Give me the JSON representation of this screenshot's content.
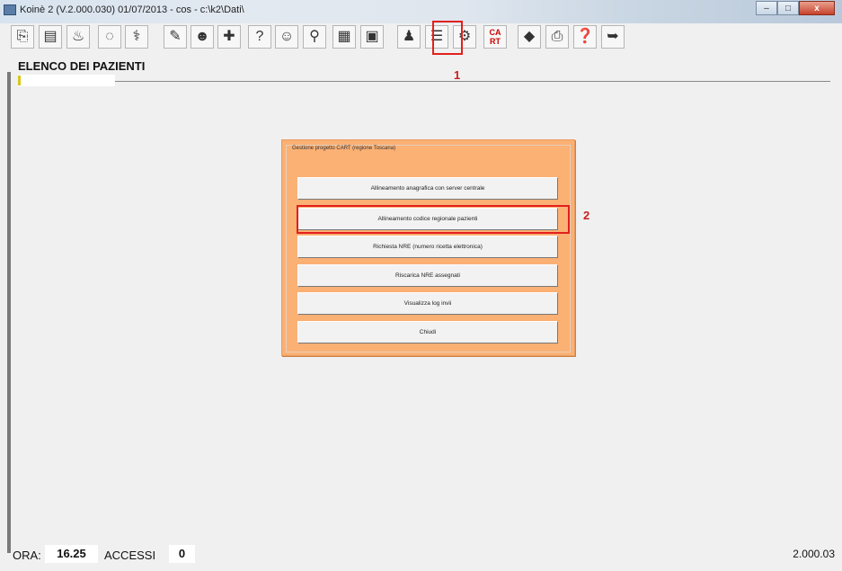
{
  "window": {
    "title": "Koinè 2 (V.2.000.030) 01/07/2013 - cos - c:\\k2\\Dati\\",
    "minimize": "–",
    "maximize": "□",
    "close": "x"
  },
  "toolbar": {
    "icons": [
      {
        "name": "open-icon",
        "glyph": "⎘"
      },
      {
        "name": "archive-icon",
        "glyph": "▤"
      },
      {
        "name": "basket-icon",
        "glyph": "♨"
      },
      {
        "name": "pill-icon",
        "glyph": "◌"
      },
      {
        "name": "medical-icon",
        "glyph": "⚕"
      },
      {
        "name": "document-icon",
        "glyph": "✎"
      },
      {
        "name": "users-icon",
        "glyph": "☻"
      },
      {
        "name": "syringe-icon",
        "glyph": "✚"
      },
      {
        "name": "question-icon",
        "glyph": "?"
      },
      {
        "name": "people-icon",
        "glyph": "☺"
      },
      {
        "name": "magnifier-icon",
        "glyph": "⚲"
      },
      {
        "name": "grid-icon",
        "glyph": "▦"
      },
      {
        "name": "calculator-icon",
        "glyph": "▣"
      },
      {
        "name": "person-group-icon",
        "glyph": "♟"
      },
      {
        "name": "list-icon",
        "glyph": "☰"
      },
      {
        "name": "network-icon",
        "glyph": "⚙"
      },
      {
        "name": "cart-icon",
        "glyph": "CA RT"
      },
      {
        "name": "eraser-icon",
        "glyph": "◆"
      },
      {
        "name": "printer-icon",
        "glyph": "⎙"
      },
      {
        "name": "help-icon",
        "glyph": "❓"
      },
      {
        "name": "exit-icon",
        "glyph": "➥"
      }
    ]
  },
  "annotations": {
    "marker1": "1",
    "marker2": "2"
  },
  "page": {
    "heading": "ELENCO DEI PAZIENTI",
    "search_value": "",
    "search_placeholder": ""
  },
  "dialog": {
    "group_title": "Gestione progetto CART (regione Toscana)",
    "buttons": [
      "Allineamento anagrafica con server centrale",
      "Allineamento codice regionale pazienti",
      "Richiesta NRE (numero ricetta elettronica)",
      "Riscarica NRE assegnati",
      "Visualizza log invii",
      "Chiudi"
    ]
  },
  "status": {
    "ora_label": "ORA:",
    "ora_value": "16.25",
    "accessi_label": "ACCESSI",
    "accessi_value": "0",
    "version": "2.000.03"
  },
  "colors": {
    "dialog_bg": "#fbb074",
    "highlight": "#e2201d",
    "marker_text": "#c82020"
  }
}
